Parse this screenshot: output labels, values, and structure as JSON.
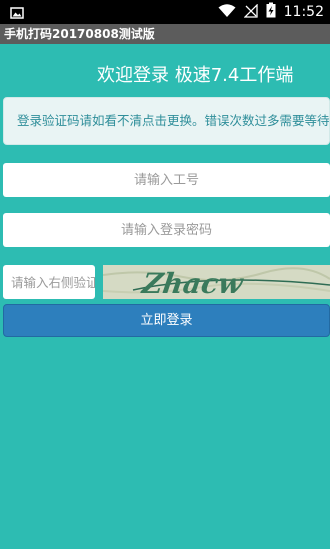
{
  "status_bar": {
    "time": "11:52"
  },
  "app_bar": {
    "title": "手机打码20170808测试版"
  },
  "welcome": {
    "text": "欢迎登录 极速7.4工作端"
  },
  "notice": {
    "text": "登录验证码请如看不清点击更换。错误次数过多需要等待"
  },
  "form": {
    "username_placeholder": "请输入工号",
    "password_placeholder": "请输入登录密码",
    "captcha_placeholder": "请输入右侧验证码",
    "captcha_text": "Zhacw",
    "login_label": "立即登录"
  },
  "colors": {
    "background": "#2dbcb2",
    "button": "#2d7fbd",
    "notice_text": "#2f8e9a"
  }
}
